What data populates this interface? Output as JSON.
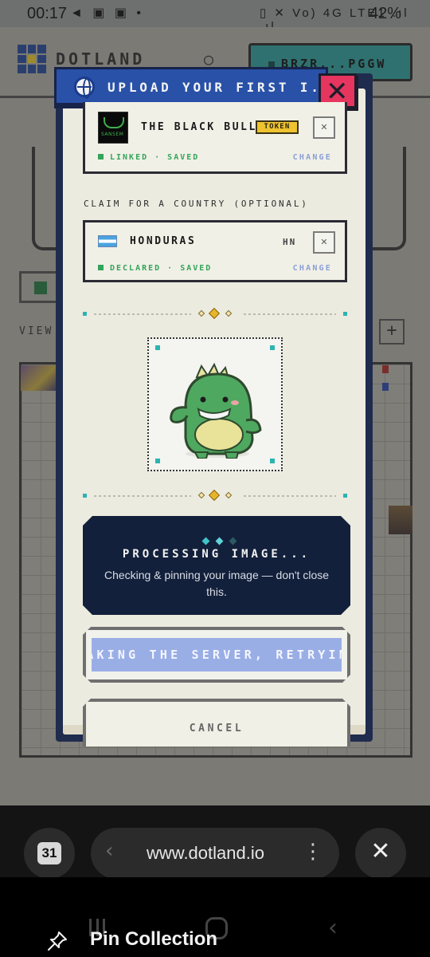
{
  "status_bar": {
    "time": "00:17",
    "left_icons": "◄ ▣ ▣ •",
    "right_icons": "▯ ✕ Vo) 4G LTE1 .ıl .ıl",
    "battery": "42%"
  },
  "background": {
    "brand": "DOTLAND",
    "wallet": "BRZR...PGGW",
    "view_label": "VIEW",
    "plus": "+"
  },
  "modal": {
    "title": "UPLOAD YOUR FIRST I...",
    "close_glyph": "✕",
    "token_card": {
      "logo_text": "SANSEM",
      "name": "THE BLACK BULL",
      "badge": "TOKEN",
      "remove": "✕",
      "status": "LINKED · SAVED",
      "change": "CHANGE"
    },
    "country_section_label": "CLAIM FOR A COUNTRY (OPTIONAL)",
    "country_card": {
      "name": "HONDURAS",
      "code": "HN",
      "remove": "✕",
      "status": "DECLARED · SAVED",
      "change": "CHANGE"
    },
    "processing": {
      "title": "PROCESSING IMAGE...",
      "description": "Checking & pinning your image — don't close this."
    },
    "retry_button": "WAKING THE SERVER, RETRYING",
    "cancel_button": "CANCEL"
  },
  "browser": {
    "tab_count": "31",
    "back_glyph": "‹",
    "url": "www.dotland.io",
    "more_glyph": "⋮",
    "close_glyph": "✕"
  },
  "toast": {
    "label": "Pin Collection"
  },
  "colors": {
    "accent_blue": "#2951a8",
    "close_red": "#e6355f",
    "status_green": "#33a45c",
    "change_blue": "#8aa0d8",
    "panel_navy": "#13203b",
    "badge_yellow": "#efc330",
    "teal": "#2db3b3"
  },
  "icons": [
    "globe-icon",
    "close-icon",
    "token-logo",
    "honduras-flag-icon",
    "dino-image",
    "pin-icon",
    "back-icon",
    "more-icon"
  ]
}
